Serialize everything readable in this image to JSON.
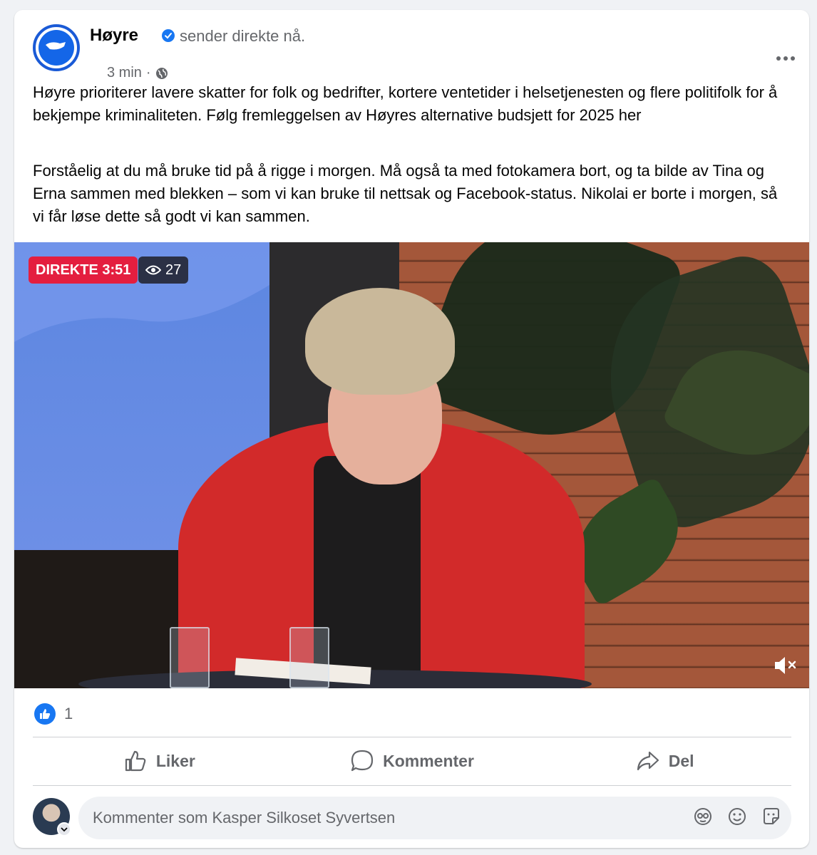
{
  "post": {
    "page_name": "Høyre",
    "status_text": "sender direkte nå.",
    "time": "3 min",
    "separator": "·",
    "privacy_icon": "globe-icon",
    "more_icon": "more-options-icon",
    "text_paragraph_1": "Høyre prioriterer lavere skatter for folk og bedrifter, kortere ventetider i helsetjenesten og flere politifolk for å bekjempe kriminaliteten. Følg fremleggelsen av Høyres alternative budsjett for 2025 her",
    "text_paragraph_2": "Forståelig at du må bruke tid på å rigge i morgen. Må også ta med fotokamera bort, og ta bilde av Tina og Erna sammen med blekken – som vi kan bruke til nettsak og Facebook-status. Nikolai er borte i morgen, så vi får løse dette så godt vi kan sammen."
  },
  "video": {
    "live_label": "DIREKTE 3:51",
    "viewers": "27",
    "mute_icon": "muted-speaker-icon"
  },
  "reactions": {
    "count": "1",
    "icon": "like-reaction-icon"
  },
  "actions": {
    "like": "Liker",
    "comment": "Kommenter",
    "share": "Del"
  },
  "comment_box": {
    "placeholder": "Kommenter som Kasper Silkoset Syvertsen",
    "icons": [
      "avatar-sticker-icon",
      "emoji-icon",
      "sticker-icon"
    ]
  },
  "colors": {
    "brand_blue": "#1466e8",
    "live_red": "#e41e3f",
    "facebook_blue": "#1877f2"
  }
}
